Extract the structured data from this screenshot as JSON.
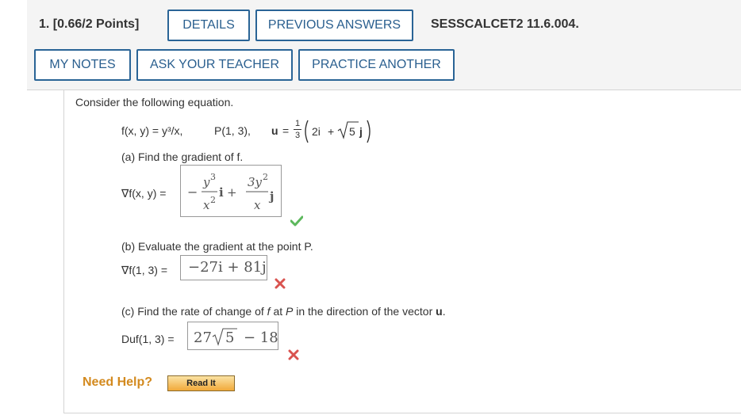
{
  "header": {
    "question_number": "1.",
    "points": "[0.66/2 Points]",
    "details_label": "DETAILS",
    "previous_answers_label": "PREVIOUS ANSWERS",
    "question_code": "SESSCALCET2 11.6.004.",
    "my_notes_label": "MY NOTES",
    "ask_teacher_label": "ASK YOUR TEACHER",
    "practice_another_label": "PRACTICE ANOTHER"
  },
  "problem": {
    "intro": "Consider the following equation.",
    "function_def": "f(x, y) = y³/x,",
    "point_def": "P(1, 3),",
    "u_label": "u",
    "u_coeff_num": "1",
    "u_coeff_den": "3",
    "u_vector_i": "2i",
    "u_plus": "+",
    "u_sqrt_arg": "5",
    "u_vector_j": "j"
  },
  "part_a": {
    "prompt": "(a) Find the gradient of f.",
    "label": "∇f(x, y)",
    "answer": {
      "minus": "−",
      "term1_num_base": "y",
      "term1_num_exp": "3",
      "term1_den_base": "x",
      "term1_den_exp": "2",
      "term1_unit": "i",
      "plus": "+",
      "term2_num": "3y",
      "term2_num_exp": "2",
      "term2_den": "x",
      "term2_unit": "j"
    },
    "status": "correct"
  },
  "part_b": {
    "prompt": "(b) Evaluate the gradient at the point P.",
    "label": "∇f(1, 3)",
    "answer": "−27i + 81j",
    "status": "incorrect"
  },
  "part_c": {
    "prompt_pre": "(c) Find the rate of change of",
    "prompt_f": "f",
    "prompt_mid": "at",
    "prompt_p": "P",
    "prompt_post": "in the direction of the vector",
    "prompt_u": "u",
    "label": "Duf(1, 3)",
    "answer_pre": "27",
    "answer_sqrt_arg": "5",
    "answer_post": "− 18",
    "status": "incorrect"
  },
  "help": {
    "need_help_label": "Need Help?",
    "read_it_label": "Read It"
  },
  "colors": {
    "button_border": "#2a6496",
    "button_text": "#2a5f8f",
    "check_green": "#5cb85c",
    "x_red": "#d9534f",
    "need_help_orange": "#d38a1f"
  }
}
